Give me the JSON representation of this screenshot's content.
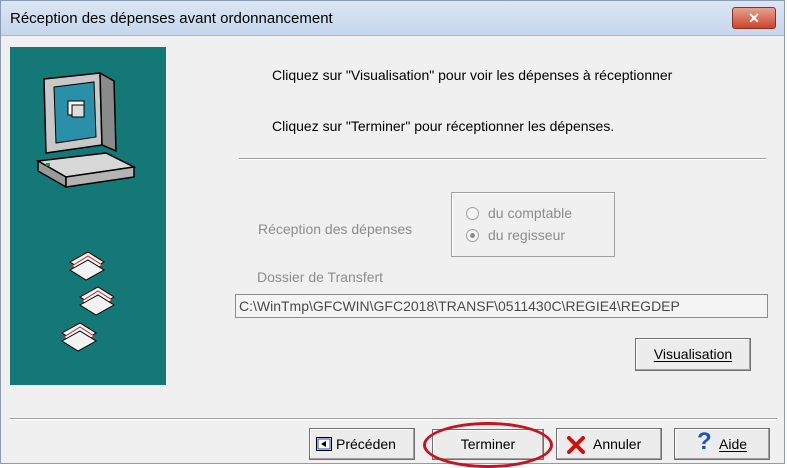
{
  "window": {
    "title": "Réception des dépenses avant ordonnancement",
    "close_glyph": "✕"
  },
  "instructions": {
    "line1": "Cliquez sur \"Visualisation\" pour voir les dépenses à réceptionner",
    "line2": "Cliquez sur \"Terminer\"  pour  réceptionner les dépenses."
  },
  "reception": {
    "label": "Réception des dépenses",
    "options": [
      {
        "label": "du comptable",
        "selected": false
      },
      {
        "label": "du regisseur",
        "selected": true
      }
    ]
  },
  "transfer": {
    "label": "Dossier de Transfert",
    "value": "C:\\WinTmp\\GFCWIN\\GFC2018\\TRANSF\\0511430C\\REGIE4\\REGDEP"
  },
  "buttons": {
    "visualisation": "Visualisation",
    "precedent": "Précéden",
    "terminer": "Terminer",
    "annuler": "Annuler",
    "aide": "Aide"
  },
  "colors": {
    "side_panel": "#137876",
    "highlight_ring": "#c3141f",
    "cancel_icon": "#cc1111",
    "help_icon": "#1f4fbf"
  },
  "icons": [
    "computer-icon",
    "documents-icon",
    "cancel-icon",
    "help-icon",
    "previous-icon",
    "close-icon"
  ]
}
